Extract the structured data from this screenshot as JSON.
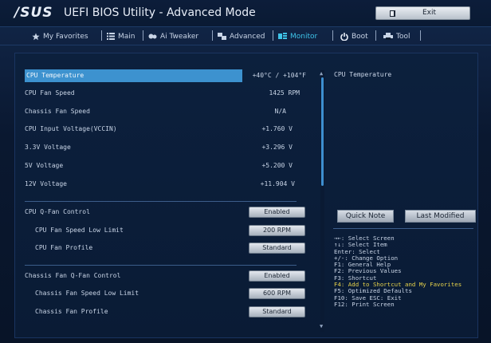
{
  "app": {
    "logo": "/SUS",
    "title": "UEFI BIOS Utility - Advanced Mode",
    "exit_label": "Exit"
  },
  "tabs": [
    {
      "label": "My Favorites",
      "icon": "star-icon"
    },
    {
      "label": "Main",
      "icon": "list-icon"
    },
    {
      "label": "Ai Tweaker",
      "icon": "tweaker-icon"
    },
    {
      "label": "Advanced",
      "icon": "advanced-icon"
    },
    {
      "label": "Monitor",
      "icon": "monitor-icon",
      "active": true
    },
    {
      "label": "Boot",
      "icon": "power-icon"
    },
    {
      "label": "Tool",
      "icon": "printer-icon"
    }
  ],
  "monitor": [
    {
      "label": "CPU Temperature",
      "value": "+40°C / +104°F"
    },
    {
      "label": "CPU Fan Speed",
      "value": "1425 RPM"
    },
    {
      "label": "Chassis Fan Speed",
      "value": "N/A"
    },
    {
      "label": "CPU Input Voltage(VCCIN)",
      "value": "+1.760 V"
    },
    {
      "label": "3.3V Voltage",
      "value": "+3.296 V"
    },
    {
      "label": "5V Voltage",
      "value": "+5.200 V"
    },
    {
      "label": "12V Voltage",
      "value": "+11.904 V"
    }
  ],
  "cpu_fan": [
    {
      "label": "CPU Q-Fan Control",
      "value": "Enabled"
    },
    {
      "label": "CPU Fan Speed Low Limit",
      "value": "200 RPM"
    },
    {
      "label": "CPU Fan Profile",
      "value": "Standard"
    }
  ],
  "chassis_fan": [
    {
      "label": "Chassis Fan Q-Fan Control",
      "value": "Enabled"
    },
    {
      "label": "Chassis Fan Speed Low Limit",
      "value": "600 RPM"
    },
    {
      "label": "Chassis Fan Profile",
      "value": "Standard"
    }
  ],
  "help": {
    "title": "CPU Temperature",
    "quick_note": "Quick Note",
    "last_modified": "Last Modified",
    "keys": [
      {
        "text": "→←: Select Screen",
        "highlight": false
      },
      {
        "text": "↑↓: Select Item",
        "highlight": false
      },
      {
        "text": "Enter: Select",
        "highlight": false
      },
      {
        "text": "+/-: Change Option",
        "highlight": false
      },
      {
        "text": "F1: General Help",
        "highlight": false
      },
      {
        "text": "F2: Previous Values",
        "highlight": false
      },
      {
        "text": "F3: Shortcut",
        "highlight": false
      },
      {
        "text": "F4: Add to Shortcut and My Favorites",
        "highlight": true
      },
      {
        "text": "F5: Optimized Defaults",
        "highlight": false
      },
      {
        "text": "F10: Save  ESC: Exit",
        "highlight": false
      },
      {
        "text": "F12: Print Screen",
        "highlight": false
      }
    ]
  },
  "colors": {
    "accent": "#3ec3e8",
    "selection": "#3d92cf",
    "highlight_key": "#e6d24a"
  }
}
